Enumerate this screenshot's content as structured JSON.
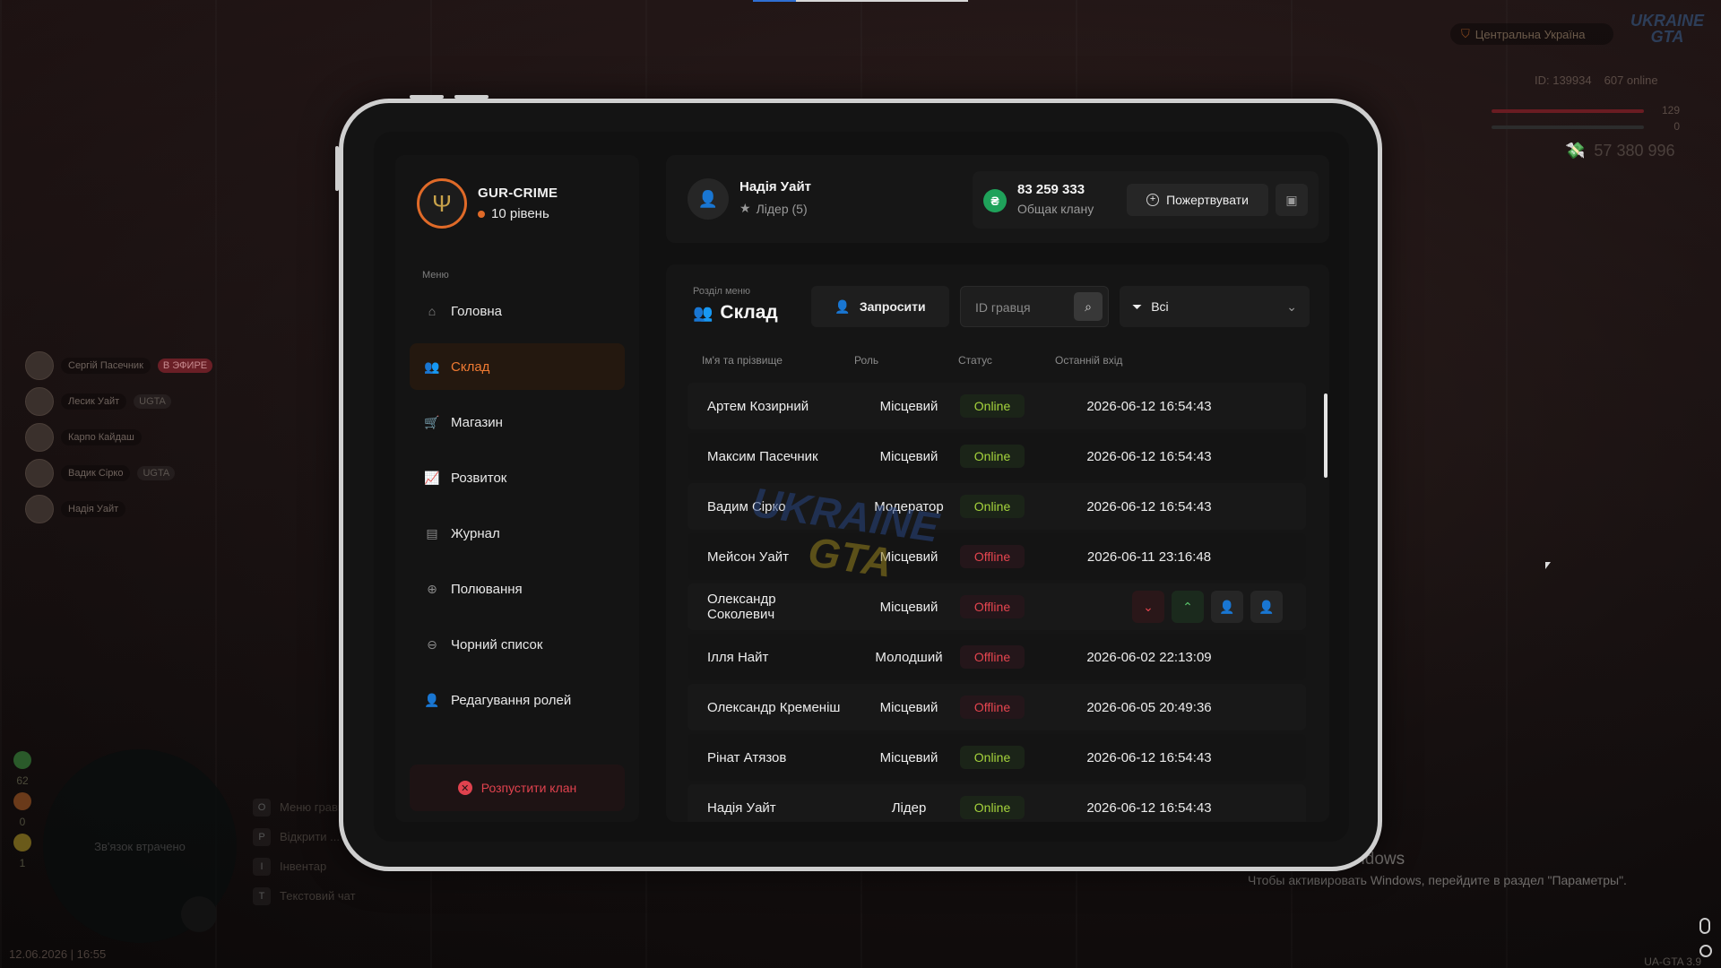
{
  "hud": {
    "region": "Центральна Україна",
    "logo": "UKRAINE GTA",
    "id_text": "ID: 139934",
    "online_text": "607 online",
    "health_value": "129",
    "armor_value": "0",
    "money": "57 380 996",
    "clock": "12.06.2026 | 16:55",
    "version": "UA-GTA 3.9",
    "radar_text": "Зв'язок втрачено"
  },
  "voice": [
    {
      "name": "Сергій Пасечник",
      "badge": "В ЭФИРЕ"
    },
    {
      "name": "Лесик Уайт",
      "badge": "UGTA"
    },
    {
      "name": "Карпо Кайдаш",
      "badge": ""
    },
    {
      "name": "Вадик Сірко",
      "badge": "UGTA"
    },
    {
      "name": "Надія Уайт",
      "badge": ""
    }
  ],
  "left_stats": [
    "62",
    "0",
    "1"
  ],
  "hotkeys": [
    {
      "key": "O",
      "label": "Меню гравця"
    },
    {
      "key": "P",
      "label": "Відкрити ..."
    },
    {
      "key": "I",
      "label": "Інвентар"
    },
    {
      "key": "T",
      "label": "Текстовий чат"
    }
  ],
  "activation": {
    "title": "Активация Windows",
    "subtitle": "Чтобы активировать Windows, перейдите в раздел \"Параметры\"."
  },
  "clan": {
    "name": "GUR-CRIME",
    "level": "10 рівень"
  },
  "menu_label": "Меню",
  "menu": [
    {
      "label": "Головна",
      "icon": "home-icon",
      "active": false
    },
    {
      "label": "Склад",
      "icon": "users-icon",
      "active": true
    },
    {
      "label": "Магазин",
      "icon": "shop-icon",
      "active": false
    },
    {
      "label": "Розвиток",
      "icon": "chart-icon",
      "active": false
    },
    {
      "label": "Журнал",
      "icon": "book-icon",
      "active": false
    },
    {
      "label": "Полювання",
      "icon": "crosshair-icon",
      "active": false
    },
    {
      "label": "Чорний список",
      "icon": "ban-icon",
      "active": false
    },
    {
      "label": "Редагування ролей",
      "icon": "user-edit-icon",
      "active": false
    }
  ],
  "disband_label": "Розпустити клан",
  "user": {
    "name": "Надія Уайт",
    "role": "Лідер (5)"
  },
  "bank": {
    "amount": "83 259 333",
    "label": "Общак клану",
    "donate_label": "Пожертвувати"
  },
  "roster": {
    "section_label": "Розділ меню",
    "title": "Склад",
    "invite_label": "Запросити",
    "search_placeholder": "ID гравця",
    "filter_value": "Всі",
    "columns": {
      "name": "Ім'я та прізвище",
      "role": "Роль",
      "status": "Статус",
      "last": "Останній вхід"
    },
    "rows": [
      {
        "name": "Артем Козирний",
        "role": "Місцевий",
        "status": "Online",
        "last": "2026-06-12 16:54:43"
      },
      {
        "name": "Максим Пасечник",
        "role": "Місцевий",
        "status": "Online",
        "last": "2026-06-12 16:54:43"
      },
      {
        "name": "Вадим Сірко",
        "role": "Модератор",
        "status": "Online",
        "last": "2026-06-12 16:54:43"
      },
      {
        "name": "Мейсон Уайт",
        "role": "Місцевий",
        "status": "Offline",
        "last": "2026-06-11 23:16:48"
      },
      {
        "name": "Олександр Соколевич",
        "role": "Місцевий",
        "status": "Offline",
        "last": "",
        "actions": true
      },
      {
        "name": "Ілля Найт",
        "role": "Молодший",
        "status": "Offline",
        "last": "2026-06-02 22:13:09"
      },
      {
        "name": "Олександр Кременіш",
        "role": "Місцевий",
        "status": "Offline",
        "last": "2026-06-05 20:49:36"
      },
      {
        "name": "Рінат Атязов",
        "role": "Місцевий",
        "status": "Online",
        "last": "2026-06-12 16:54:43"
      },
      {
        "name": "Надія Уайт",
        "role": "Лідер",
        "status": "Online",
        "last": "2026-06-12 16:54:43"
      }
    ]
  },
  "colors": {
    "accent": "#ef7a32",
    "online": "#a5d33c",
    "offline": "#e5454f",
    "bank": "#1fa25a"
  }
}
